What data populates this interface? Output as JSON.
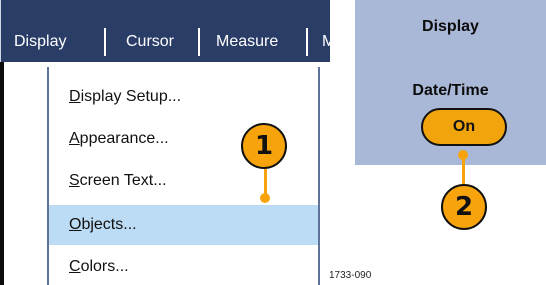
{
  "menubar": {
    "items": [
      {
        "label": "Display"
      },
      {
        "label": "Cursor"
      },
      {
        "label": "Measure"
      },
      {
        "label": "M"
      }
    ]
  },
  "dropdown": {
    "items": [
      {
        "mnemonic": "D",
        "rest": "isplay Setup..."
      },
      {
        "mnemonic": "A",
        "rest": "ppearance..."
      },
      {
        "mnemonic": "S",
        "rest": "creen Text..."
      },
      {
        "mnemonic": "O",
        "rest": "bjects..."
      },
      {
        "mnemonic": "C",
        "rest": "olors..."
      }
    ],
    "highlighted_index": 3
  },
  "side_menu": {
    "title": "Display",
    "option_label": "Date/Time",
    "option_value": "On"
  },
  "callouts": [
    "1",
    "2"
  ],
  "figure_id": "1733-090",
  "colors": {
    "menubar_bg": "#2a3d66",
    "side_bg": "#aab8d8",
    "highlight": "#bcdcf5",
    "callout": "#f7a40c"
  }
}
